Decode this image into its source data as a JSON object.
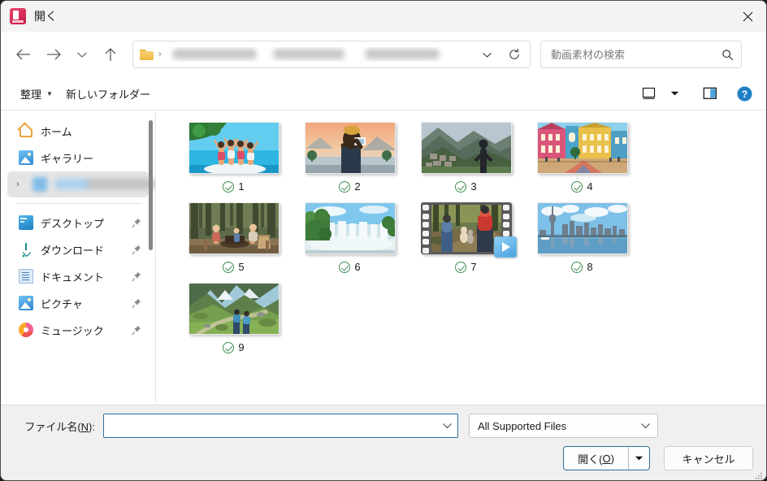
{
  "window": {
    "title": "開く",
    "app_icon": "app-icon",
    "close_label": "✕"
  },
  "nav": {
    "back": "←",
    "forward": "→",
    "recent": "⌄",
    "up": "↑",
    "breadcrumb_redacted": true,
    "breadcrumb_separator": "›",
    "address_dropdown": "⌄",
    "refresh": "↻"
  },
  "search": {
    "placeholder": "動画素材の検索",
    "value": "",
    "icon": "search-icon"
  },
  "commandbar": {
    "organize_label": "整理",
    "organize_caret": "▼",
    "new_folder_label": "新しいフォルダー",
    "view_icon": "view-icon",
    "view_caret": "▼",
    "preview_pane_icon": "preview-pane-icon",
    "help_icon": "?"
  },
  "sidebar": {
    "items": [
      {
        "label": "ホーム",
        "icon": "home-icon",
        "pinned": false,
        "selected": false,
        "expandable": false
      },
      {
        "label": "ギャラリー",
        "icon": "gallery-icon",
        "pinned": false,
        "selected": false,
        "expandable": false
      },
      {
        "label": "",
        "icon": "cloud-icon",
        "pinned": false,
        "selected": true,
        "expandable": true,
        "redacted": true
      },
      {
        "label": "デスクトップ",
        "icon": "desktop-icon",
        "pinned": true,
        "selected": false,
        "expandable": false
      },
      {
        "label": "ダウンロード",
        "icon": "download-icon",
        "pinned": true,
        "selected": false,
        "expandable": false
      },
      {
        "label": "ドキュメント",
        "icon": "documents-icon",
        "pinned": true,
        "selected": false,
        "expandable": false
      },
      {
        "label": "ピクチャ",
        "icon": "pictures-icon",
        "pinned": true,
        "selected": false,
        "expandable": false
      },
      {
        "label": "ミュージック",
        "icon": "music-icon",
        "pinned": true,
        "selected": false,
        "expandable": false
      }
    ],
    "chevron": "›",
    "pin_glyph": "📌"
  },
  "content": {
    "files": [
      {
        "name": "1",
        "checked": true,
        "kind": "image",
        "scene": "beach-toast-friends"
      },
      {
        "name": "2",
        "checked": true,
        "kind": "image",
        "scene": "traveler-photographing-sunset"
      },
      {
        "name": "3",
        "checked": true,
        "kind": "image",
        "scene": "machu-picchu-hiker"
      },
      {
        "name": "4",
        "checked": true,
        "kind": "image",
        "scene": "colorful-colonial-plaza"
      },
      {
        "name": "5",
        "checked": true,
        "kind": "image",
        "scene": "forest-campsite-family"
      },
      {
        "name": "6",
        "checked": true,
        "kind": "image",
        "scene": "iguazu-waterfalls"
      },
      {
        "name": "7",
        "checked": true,
        "kind": "video",
        "scene": "hikers-forest-trail"
      },
      {
        "name": "8",
        "checked": true,
        "kind": "image",
        "scene": "toronto-skyline-waterfront"
      },
      {
        "name": "9",
        "checked": true,
        "kind": "image",
        "scene": "alpine-valley-hikers"
      }
    ]
  },
  "footer": {
    "filename_label_before": "ファイル名(",
    "filename_label_key": "N",
    "filename_label_after": "):",
    "filename_value": "",
    "filename_caret": "⌄",
    "filter_value": "All Supported Files",
    "filter_caret": "⌄",
    "open_label_before": "開く(",
    "open_label_key": "O",
    "open_label_after": ")",
    "open_caret": "▼",
    "cancel_label": "キャンセル"
  },
  "colors": {
    "accent": "#2f6f9f",
    "check_green": "#3f8f52",
    "help_blue": "#1f7fc4",
    "title_bg": "#f3f3f3",
    "footer_bg": "#f0f0f0"
  }
}
